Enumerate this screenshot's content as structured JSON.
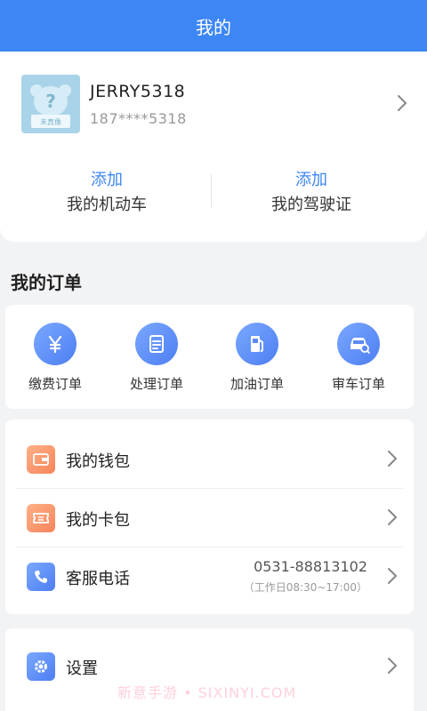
{
  "header": {
    "title": "我的"
  },
  "profile": {
    "username": "JERRY5318",
    "phone": "187****5318",
    "avatar_text": "?",
    "avatar_caption": "未真像"
  },
  "quick_actions": [
    {
      "add_label": "添加",
      "label": "我的机动车"
    },
    {
      "add_label": "添加",
      "label": "我的驾驶证"
    }
  ],
  "orders": {
    "section_title": "我的订单",
    "items": [
      {
        "label": "缴费订单",
        "icon": "yen-icon"
      },
      {
        "label": "处理订单",
        "icon": "document-icon"
      },
      {
        "label": "加油订单",
        "icon": "fuel-pump-icon"
      },
      {
        "label": "审车订单",
        "icon": "car-inspect-icon"
      }
    ]
  },
  "menu": {
    "wallet_label": "我的钱包",
    "cardpack_label": "我的卡包",
    "service_label": "客服电话",
    "service_phone": "0531-88813102",
    "service_hours": "（工作日08:30~17:00）"
  },
  "settings": {
    "label": "设置"
  },
  "watermark": "新意手游 • SIXINYI.COM",
  "colors": {
    "primary": "#3d86f5",
    "orange": "#f7845a",
    "background": "#f2f3f5"
  }
}
